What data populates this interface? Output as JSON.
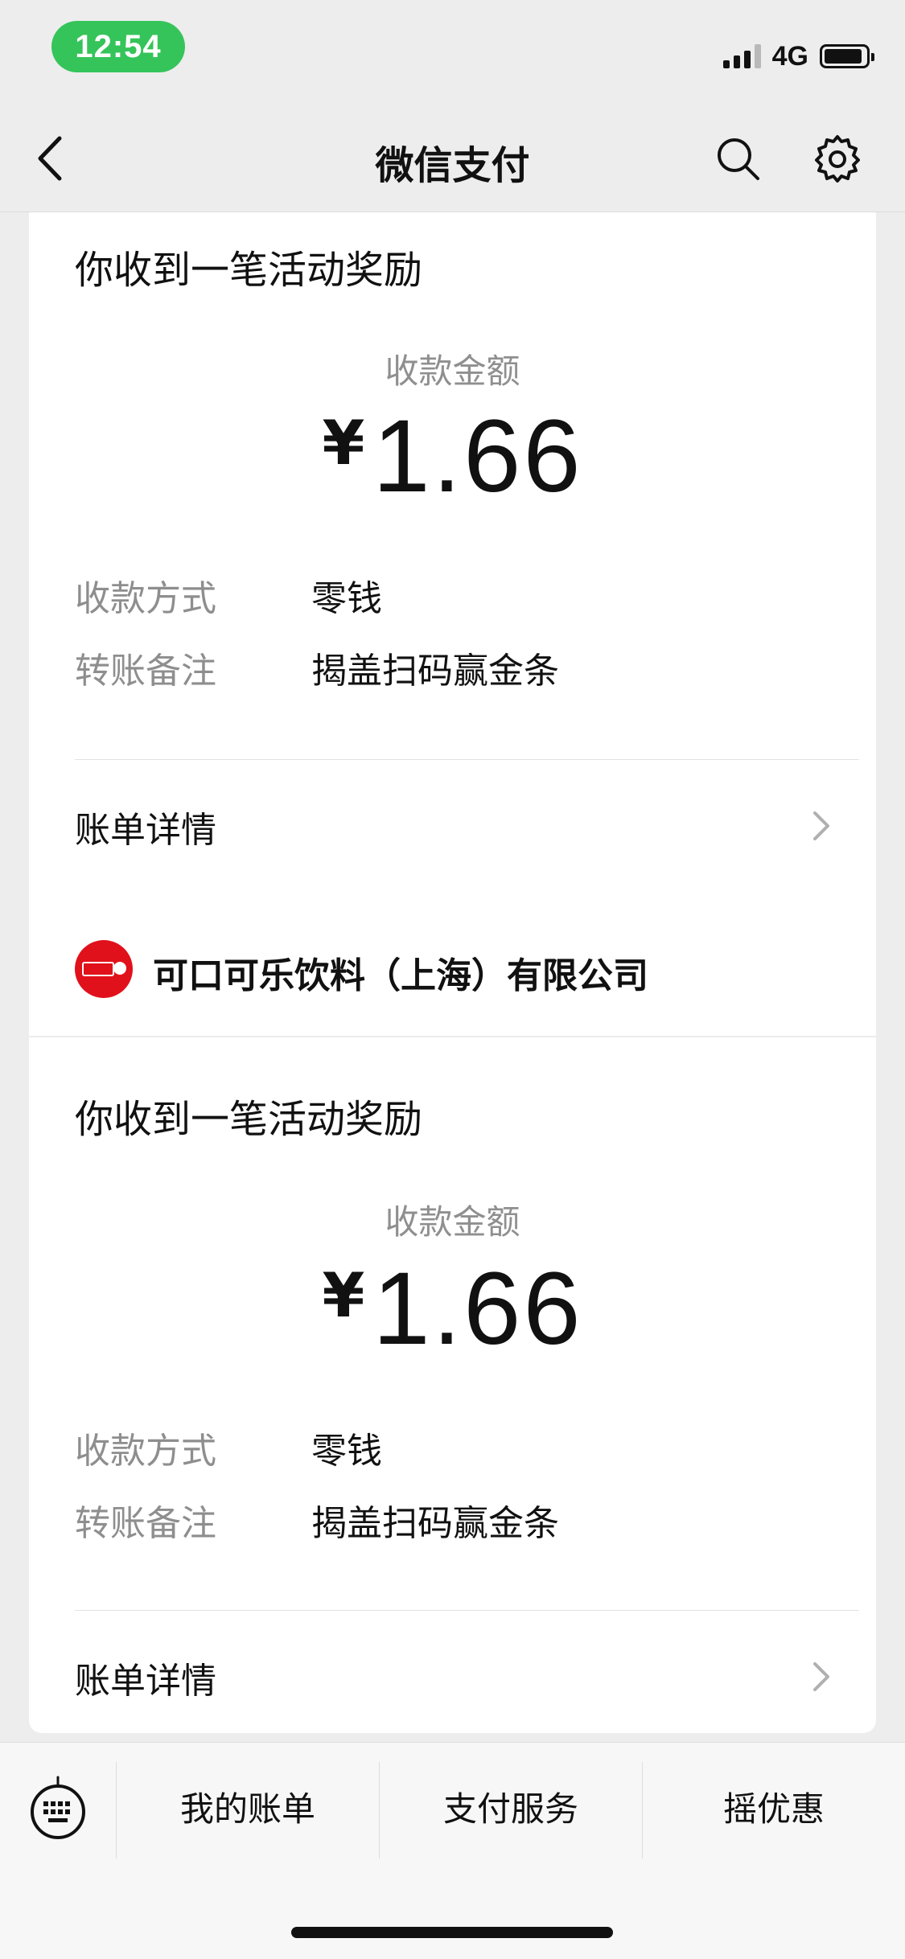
{
  "status": {
    "time": "12:54",
    "network": "4G",
    "icons": {
      "signal": "signal-icon",
      "battery": "battery-icon"
    }
  },
  "nav": {
    "title": "微信支付",
    "back_icon": "back-arrow-icon",
    "search_icon": "search-icon",
    "settings_icon": "settings-icon"
  },
  "cards": [
    {
      "activity_title": "你收到一笔活动奖励",
      "amount_label": "收款金额",
      "currency": "¥",
      "amount": "1.66",
      "details": [
        {
          "label": "收款方式",
          "value": "零钱"
        },
        {
          "label": "转账备注",
          "value": "揭盖扫码赢金条"
        }
      ],
      "bill_detail": "账单详情"
    },
    {
      "merchant_name": "可口可乐饮料（上海）有限公司",
      "merchant_logo": "coca-cola-logo-icon",
      "activity_title": "你收到一笔活动奖励",
      "amount_label": "收款金额",
      "currency": "¥",
      "amount": "1.66",
      "details": [
        {
          "label": "收款方式",
          "value": "零钱"
        },
        {
          "label": "转账备注",
          "value": "揭盖扫码赢金条"
        }
      ],
      "bill_detail": "账单详情"
    }
  ],
  "bottom_menu": {
    "keyboard_icon": "keyboard-icon",
    "items": [
      "我的账单",
      "支付服务",
      "摇优惠"
    ]
  },
  "colors": {
    "status_pill": "#35c45a",
    "merchant_logo": "#e0111b",
    "background": "#ededed",
    "card": "#ffffff"
  }
}
